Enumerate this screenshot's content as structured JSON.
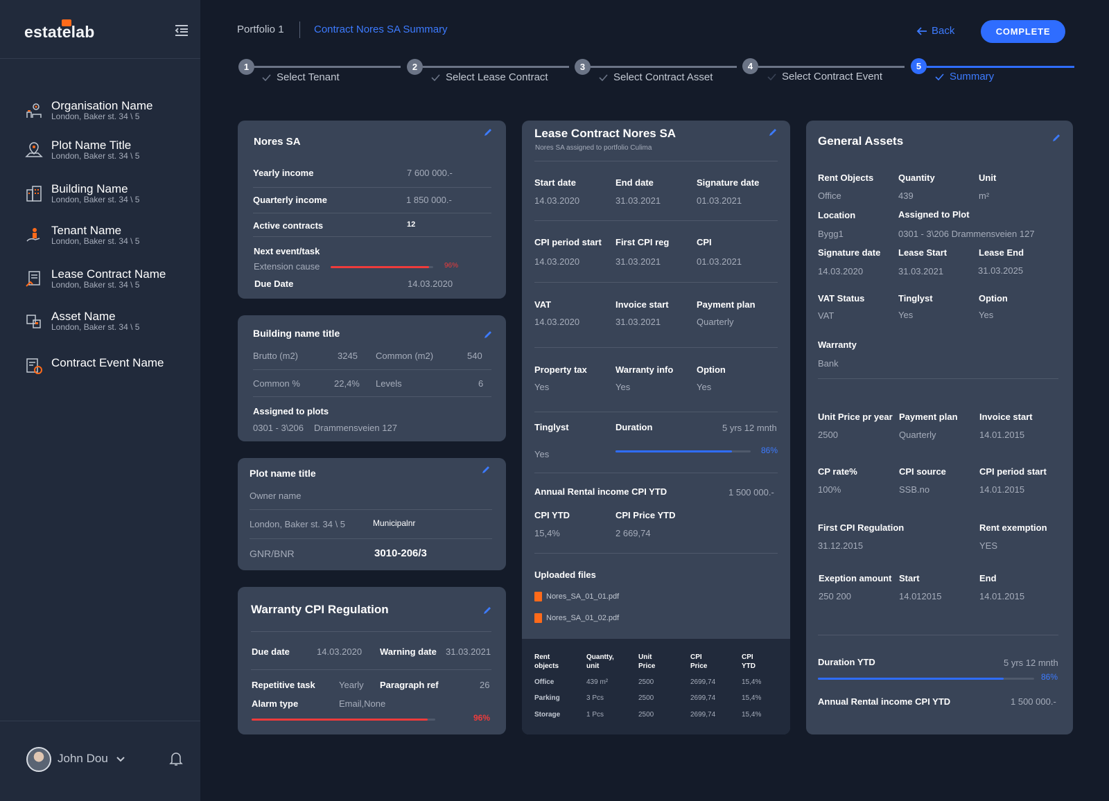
{
  "app": {
    "logo": "estatelab"
  },
  "sidebar": {
    "items": [
      {
        "icon": "organisation-icon",
        "title": "Organisation Name",
        "sub": "London, Baker st. 34 \\ 5"
      },
      {
        "icon": "plot-pin-icon",
        "title": "Plot Name Title",
        "sub": "London, Baker st. 34 \\ 5"
      },
      {
        "icon": "building-icon",
        "title": "Building Name",
        "sub": "London, Baker st. 34 \\ 5"
      },
      {
        "icon": "tenant-icon",
        "title": "Tenant Name",
        "sub": "London, Baker st. 34 \\ 5"
      },
      {
        "icon": "lease-contract-icon",
        "title": "Lease Contract Name",
        "sub": "London, Baker st. 34 \\ 5"
      },
      {
        "icon": "asset-icon",
        "title": "Asset Name",
        "sub": "London, Baker st. 34 \\ 5"
      },
      {
        "icon": "contract-event-icon",
        "title": "Contract Event Name",
        "sub": ""
      }
    ],
    "user": {
      "name": "John Dou"
    }
  },
  "header": {
    "breadcrumb": [
      "Portfolio 1",
      "Contract Nores SA Summary"
    ],
    "back_label": "Back",
    "complete_label": "COMPLETE"
  },
  "stepper": {
    "steps": [
      {
        "num": "1",
        "label": "Select Tenant"
      },
      {
        "num": "2",
        "label": "Select Lease Contract"
      },
      {
        "num": "3",
        "label": "Select Contract Asset"
      },
      {
        "num": "4",
        "label": "Select Contract Event"
      },
      {
        "num": "5",
        "label": "Summary"
      }
    ],
    "active_step": 5
  },
  "tenant_card": {
    "title": "Nores SA",
    "rows": [
      {
        "label": "Yearly income",
        "value": "7 600 000.-"
      },
      {
        "label": "Quarterly income",
        "value": "1 850 000.-"
      },
      {
        "label": "Active contracts",
        "value": "12"
      }
    ],
    "next_event_label": "Next event/task",
    "extension_label": "Extension cause",
    "extension_pct": "96%",
    "extension_fraction": 0.96,
    "due_label": "Due Date",
    "due_value": "14.03.2020"
  },
  "building_card": {
    "title": "Building name title",
    "brutto_label": "Brutto (m2)",
    "brutto_value": "3245",
    "common_label": "Common (m2)",
    "common_value": "540",
    "common_pct_label": "Common %",
    "common_pct_value": "22,4%",
    "levels_label": "Levels",
    "levels_value": "6",
    "assigned_label": "Assigned to plots",
    "plot_code": "0301 - 3\\206",
    "plot_addr": "Drammensveien 127"
  },
  "plot_card": {
    "title": "Plot name title",
    "owner": "Owner name",
    "address": "London, Baker st. 34 \\ 5",
    "municipal_label": "Municipalnr",
    "gnr_label": "GNR/BNR",
    "gnr_value": "3010-206/3"
  },
  "warranty_card": {
    "title": "Warranty CPI Regulation",
    "due_label": "Due date",
    "due_value": "14.03.2020",
    "warning_label": "Warning date",
    "warning_value": "31.03.2021",
    "repetitive_label": "Repetitive task",
    "repetitive_value": "Yearly",
    "paragraph_label": "Paragraph ref",
    "paragraph_value": "26",
    "alarm_label": "Alarm type",
    "alarm_value": "Email,None",
    "progress_pct": "96%",
    "progress_fraction": 0.96
  },
  "lease_card": {
    "title": "Lease Contract Nores SA",
    "subtitle": "Nores SA assigned to portfolio Culima",
    "grid": [
      [
        {
          "label": "Start date",
          "value": "14.03.2020"
        },
        {
          "label": "End date",
          "value": "31.03.2021"
        },
        {
          "label": "Signature date",
          "value": "01.03.2021"
        }
      ],
      [
        {
          "label": "CPI period start",
          "value": "14.03.2020"
        },
        {
          "label": "First CPI reg",
          "value": "31.03.2021"
        },
        {
          "label": "CPI",
          "value": "01.03.2021"
        }
      ],
      [
        {
          "label": "VAT",
          "value": "14.03.2020"
        },
        {
          "label": "Invoice start",
          "value": "31.03.2021"
        },
        {
          "label": "Payment plan",
          "value": "Quarterly"
        }
      ],
      [
        {
          "label": "Property tax",
          "value": "Yes"
        },
        {
          "label": "Warranty info",
          "value": "Yes"
        },
        {
          "label": "Option",
          "value": "Yes"
        }
      ]
    ],
    "tinglyst_label": "Tinglyst",
    "tinglyst_value": "Yes",
    "duration_label": "Duration",
    "duration_value": "5 yrs 12 mnth",
    "duration_pct": "86%",
    "duration_fraction": 0.86,
    "annual_label": "Annual Rental income CPI YTD",
    "annual_value": "1 500 000.-",
    "cpi_ytd_label": "CPI YTD",
    "cpi_ytd_value": "15,4%",
    "cpi_price_label": "CPI Price YTD",
    "cpi_price_value": "2 669,74",
    "files_label": "Uploaded files",
    "files": [
      "Nores_SA_01_01.pdf",
      "Nores_SA_01_02.pdf"
    ],
    "table": {
      "headers": [
        [
          "Rent",
          "objects"
        ],
        [
          "Quantty,",
          "unit"
        ],
        [
          "Unit",
          "Price"
        ],
        [
          "CPI",
          "Price"
        ],
        [
          "CPI",
          "YTD"
        ]
      ],
      "rows": [
        [
          "Office",
          "439 m²",
          "2500",
          "2699,74",
          "15,4%"
        ],
        [
          "Parking",
          "3 Pcs",
          "2500",
          "2699,74",
          "15,4%"
        ],
        [
          "Storage",
          "1 Pcs",
          "2500",
          "2699,74",
          "15,4%"
        ]
      ]
    }
  },
  "assets_card": {
    "title": "General Assets",
    "rent_objects_label": "Rent Objects",
    "rent_objects_value": "Office",
    "quantity_label": "Quantity",
    "quantity_value": "439",
    "unit_label": "Unit",
    "unit_value": "m²",
    "location_label": "Location",
    "location_value": "Bygg1",
    "assigned_label": "Assigned to Plot",
    "assigned_value": "0301 - 3\\206 Drammensveien 127",
    "signature_label": "Signature date",
    "signature_value": "14.03.2020",
    "lease_start_label": "Lease Start",
    "lease_start_value": "31.03.2021",
    "lease_end_label": "Lease End",
    "lease_end_value": "31.03.2025",
    "vat_label": "VAT Status",
    "vat_value": "VAT",
    "tinglyst_label": "Tinglyst",
    "tinglyst_value": "Yes",
    "option_label": "Option",
    "option_value": "Yes",
    "warranty_label": "Warranty",
    "warranty_value": "Bank",
    "unit_price_label": "Unit Price pr year",
    "unit_price_value": "2500",
    "payment_label": "Payment plan",
    "payment_value": "Quarterly",
    "invoice_label": "Invoice start",
    "invoice_value": "14.01.2015",
    "cp_rate_label": "CP rate%",
    "cp_rate_value": "100%",
    "cpi_source_label": "CPI source",
    "cpi_source_value": "SSB.no",
    "cpi_period_label": "CPI period start",
    "cpi_period_value": "14.01.2015",
    "first_cpi_label": "First CPI Regulation",
    "first_cpi_value": "31.12.2015",
    "rent_ex_label": "Rent exemption",
    "rent_ex_value": "YES",
    "exemption_label": "Exeption amount",
    "exemption_value": "250 200",
    "start_label": "Start",
    "start_value": "14.012015",
    "end_label": "End",
    "end_value": "14.01.2015",
    "duration_label": "Duration YTD",
    "duration_value": "5 yrs 12 mnth",
    "duration_pct": "86%",
    "duration_fraction": 0.86,
    "annual_label": "Annual Rental income CPI YTD",
    "annual_value": "1 500 000.-"
  },
  "colors": {
    "accent": "#2f6dff",
    "danger": "#ef3b3b",
    "brand_orange": "#ff6a1a",
    "card": "#394457",
    "bg": "#141b29"
  }
}
